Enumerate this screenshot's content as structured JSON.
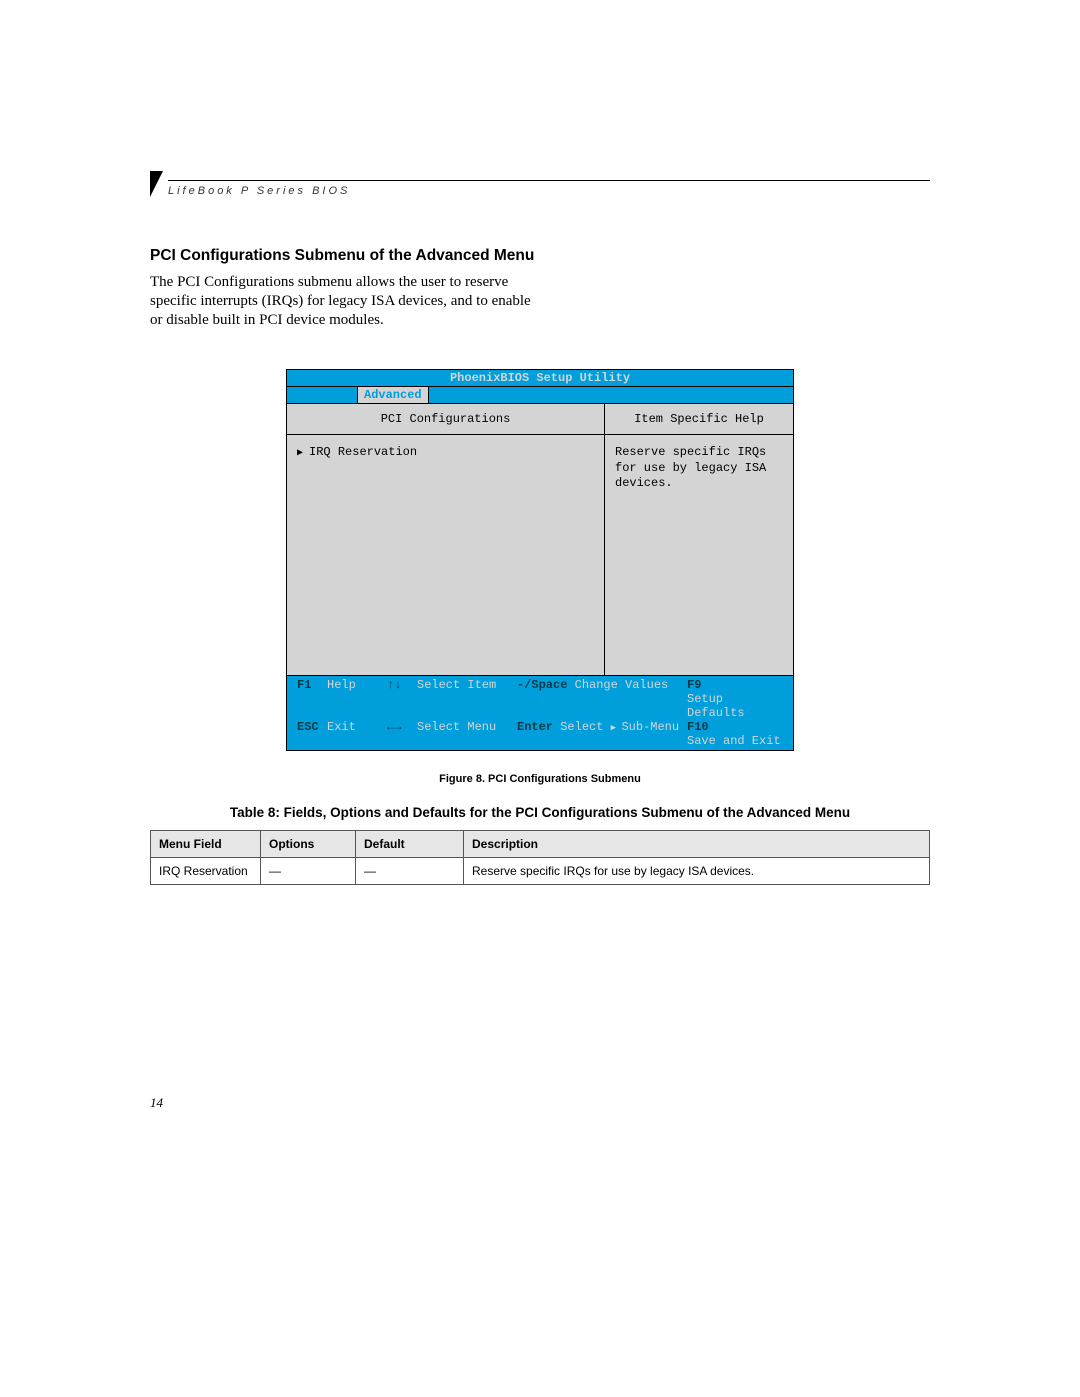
{
  "header": {
    "running_head": "LifeBook P Series BIOS"
  },
  "section": {
    "title": "PCI Configurations Submenu of the Advanced Menu",
    "body": "The PCI Configurations submenu allows the user to reserve specific interrupts (IRQs) for legacy ISA devices, and to enable or disable built in PCI device modules."
  },
  "bios": {
    "utility_title": "PhoenixBIOS Setup Utility",
    "active_tab": "Advanced",
    "left_heading": "PCI Configurations",
    "right_heading": "Item Specific Help",
    "menu_item": "IRQ Reservation",
    "help_text": "Reserve specific IRQs for use by legacy ISA devices.",
    "footer": {
      "row1": {
        "k1": "F1",
        "l1": "Help",
        "k2": "↑↓",
        "l2": "Select Item",
        "k3": "-/Space",
        "l3": "Change Values",
        "k4": "F9",
        "l4": "Setup Defaults"
      },
      "row2": {
        "k1": "ESC",
        "l1": "Exit",
        "k2": "←→",
        "l2": "Select Menu",
        "k3": "Enter",
        "l3": "Select",
        "l3b": "Sub-Menu",
        "k4": "F10",
        "l4": "Save and Exit"
      }
    }
  },
  "figure_caption": "Figure 8.  PCI Configurations Submenu",
  "table_caption": "Table 8: Fields, Options and Defaults for the PCI Configurations Submenu of the Advanced Menu",
  "table": {
    "headers": {
      "c1": "Menu Field",
      "c2": "Options",
      "c3": "Default",
      "c4": "Description"
    },
    "rows": [
      {
        "c1": "IRQ Reservation",
        "c2": "—",
        "c3": "—",
        "c4": "Reserve specific IRQs for use by legacy ISA devices."
      }
    ]
  },
  "page_number": "14"
}
